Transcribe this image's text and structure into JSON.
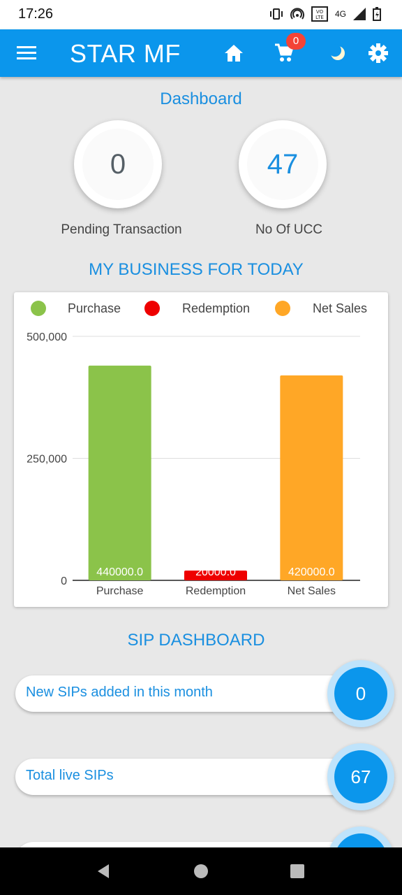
{
  "status_bar": {
    "time": "17:26",
    "network": "4G"
  },
  "app_bar": {
    "title": "STAR MF",
    "cart_count": "0"
  },
  "dashboard": {
    "title": "Dashboard",
    "pending_value": "0",
    "pending_label": "Pending Transaction",
    "ucc_value": "47",
    "ucc_label": "No Of UCC"
  },
  "business": {
    "title": "MY BUSINESS FOR TODAY",
    "legend": [
      "Purchase",
      "Redemption",
      "Net Sales"
    ]
  },
  "chart_data": {
    "type": "bar",
    "categories": [
      "Purchase",
      "Redemption",
      "Net Sales"
    ],
    "values": [
      440000,
      20000,
      420000
    ],
    "value_labels": [
      "440000.0",
      "20000.0",
      "420000.0"
    ],
    "colors": [
      "#8bc34a",
      "#ee0000",
      "#ffa726"
    ],
    "yticks": [
      "500,000",
      "250,000",
      "0"
    ],
    "ylim": [
      0,
      500000
    ],
    "grid": true,
    "legend_position": "top"
  },
  "sip": {
    "title": "SIP DASHBOARD",
    "rows": [
      {
        "label": "New SIPs added in this month",
        "value": "0"
      },
      {
        "label": "Total live SIPs",
        "value": "67"
      }
    ]
  }
}
